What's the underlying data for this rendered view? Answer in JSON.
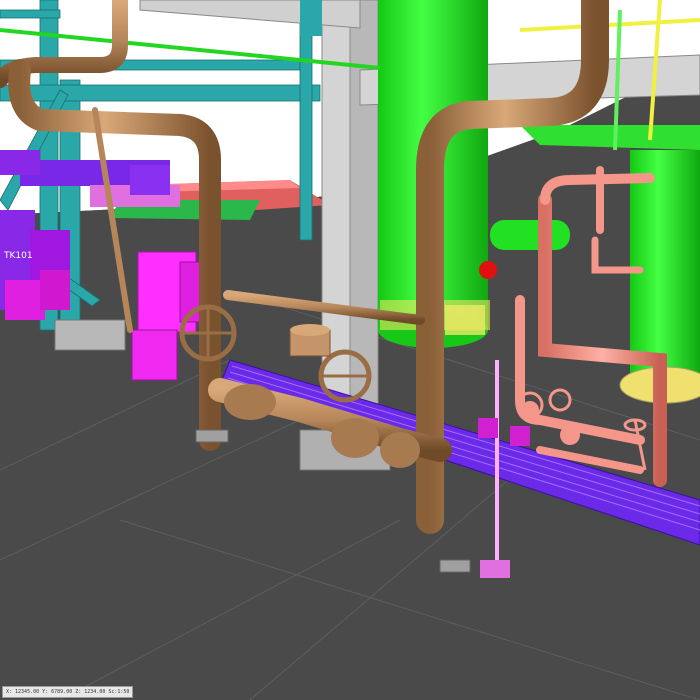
{
  "view": {
    "background_top": "#ffffff",
    "floor": "#4a4a4a"
  },
  "equipment_tag": "TK101",
  "status_bar": {
    "coordinates": "X: 12345.00 Y: 6789.00 Z: 1234.00 Sc:1:50"
  },
  "colors": {
    "pipe_brown": "#b5865a",
    "pipe_pink": "#f4968a",
    "vessel_green": "#22f522",
    "steel_teal": "#2aa7a8",
    "steel_grey": "#cfcfcf",
    "magenta": "#e020e0",
    "purple": "#7a28e8",
    "floor_grid": "#5a5a5a"
  }
}
